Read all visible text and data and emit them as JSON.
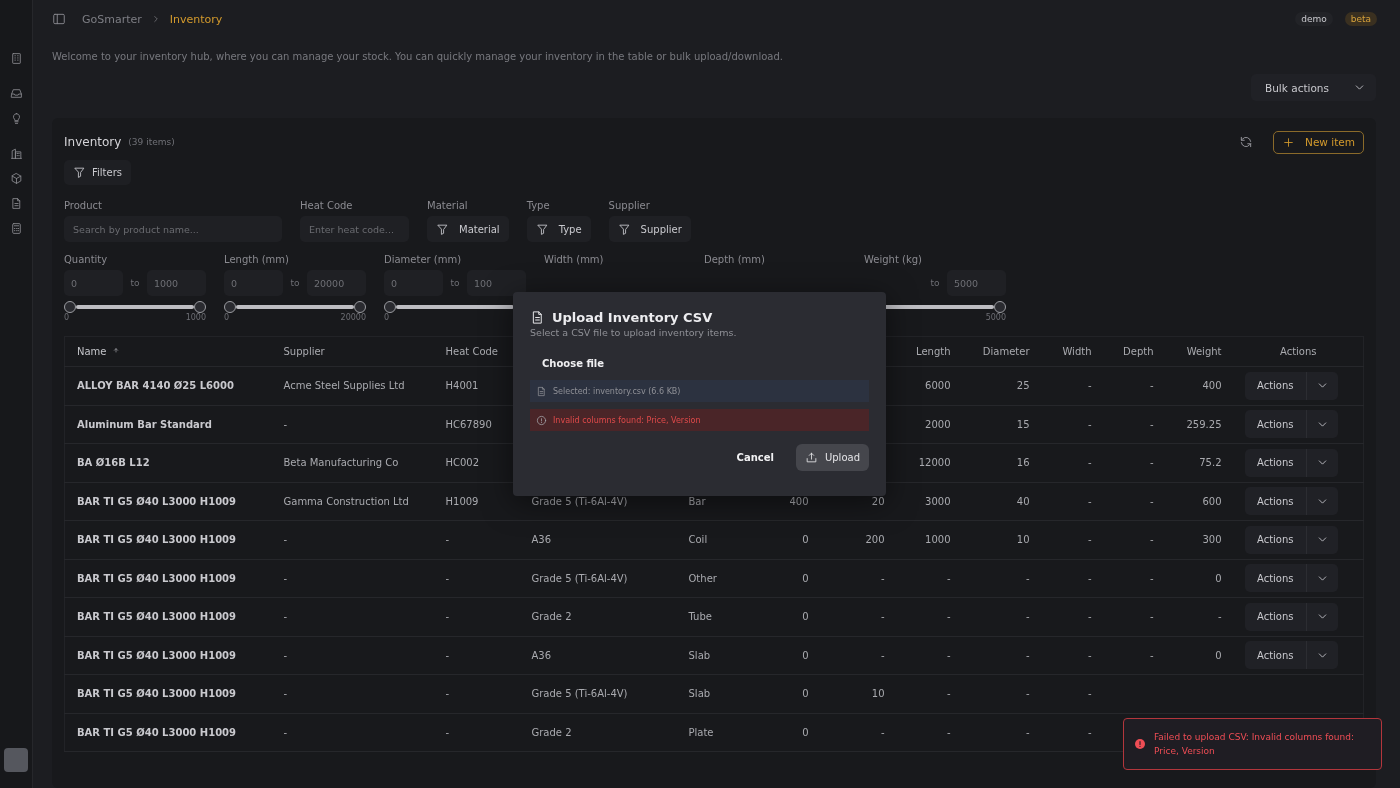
{
  "breadcrumb": {
    "items": [
      {
        "label": "GoSmarter",
        "selected": false
      },
      {
        "label": "Inventory",
        "selected": true
      }
    ]
  },
  "user_badges": [
    {
      "label": "demo",
      "kind": "plain"
    },
    {
      "label": "beta",
      "kind": "accent"
    }
  ],
  "description": "Welcome to your inventory hub, where you can manage your stock. You can quickly manage your inventory in the table or bulk upload/download.",
  "bulk_actions": {
    "label": "Bulk actions"
  },
  "card": {
    "title": "Inventory",
    "count": "(39 items)",
    "new_item": "New item",
    "filters_button": "Filters",
    "text_filters": [
      {
        "label": "Product",
        "kind": "input",
        "placeholder": "Search by product name..."
      },
      {
        "label": "Heat Code",
        "kind": "input",
        "placeholder": "Enter heat code..."
      },
      {
        "label": "Material",
        "kind": "select",
        "value": "Material"
      },
      {
        "label": "Type",
        "kind": "select",
        "value": "Type"
      },
      {
        "label": "Supplier",
        "kind": "select",
        "value": "Supplier"
      }
    ],
    "range_filters": [
      {
        "label": "Quantity",
        "min": "0",
        "to": "to",
        "max": "1000",
        "tick_min": "0",
        "tick_max": "1000",
        "thumbs": [
          {
            "level": 0
          },
          {
            "level": 1
          }
        ]
      },
      {
        "label": "Length (mm)",
        "min": "0",
        "to": "to",
        "max": "20000",
        "tick_min": "0",
        "tick_max": "20000",
        "thumbs": [
          {
            "level": 0
          },
          {
            "level": 1
          }
        ]
      },
      {
        "label": "Diameter (mm)",
        "min": "0",
        "to": "to",
        "max": "100",
        "tick_min": "0",
        "thumbs": [
          {
            "level": 0
          }
        ]
      },
      {
        "label": "Width (mm)"
      },
      {
        "label": "Depth (mm)"
      },
      {
        "label": "Weight (kg)",
        "to": "to",
        "max": "5000",
        "tick_max": "5000",
        "thumbs": [
          {
            "level": 1
          }
        ]
      }
    ]
  },
  "table": {
    "columns": [
      {
        "label": "Name",
        "sorted": true
      },
      {
        "label": "Supplier",
        "sorted": false
      },
      {
        "label": "Heat Code",
        "sorted": false
      },
      {},
      {},
      {},
      {},
      {
        "label": "Length",
        "sorted": false
      },
      {
        "label": "Diameter",
        "sorted": false
      },
      {
        "label": "Width",
        "sorted": false
      },
      {
        "label": "Depth",
        "sorted": false
      },
      {
        "label": "Weight",
        "sorted": false
      },
      {
        "label": "Actions",
        "sorted": false
      }
    ],
    "rows": [
      {
        "cells": [
          "ALLOY BAR 4140 Ø25 L6000",
          "Acme Steel Supplies Ltd",
          "H4001",
          null,
          null,
          null,
          null,
          "6000",
          "25",
          "-",
          "-",
          "400"
        ],
        "action": "Actions"
      },
      {
        "cells": [
          "Aluminum Bar Standard",
          "-",
          "HC67890",
          null,
          null,
          null,
          null,
          "2000",
          "15",
          "-",
          "-",
          "259.25"
        ],
        "action": "Actions"
      },
      {
        "cells": [
          "BA Ø16B L12",
          "Beta Manufacturing Co",
          "HC002",
          null,
          null,
          null,
          null,
          "12000",
          "16",
          "-",
          "-",
          "75.2"
        ],
        "action": "Actions"
      },
      {
        "cells": [
          "BAR TI G5 Ø40 L3000 H1009",
          "Gamma Construction Ltd",
          "H1009",
          "Grade 5 (Ti-6Al-4V)",
          "Bar",
          "400",
          "20",
          "3000",
          "40",
          "-",
          "-",
          "600"
        ],
        "action": "Actions"
      },
      {
        "cells": [
          "BAR TI G5 Ø40 L3000 H1009",
          "-",
          "-",
          "A36",
          "Coil",
          "0",
          "200",
          "1000",
          "10",
          "-",
          "-",
          "300"
        ],
        "action": "Actions"
      },
      {
        "cells": [
          "BAR TI G5 Ø40 L3000 H1009",
          "-",
          "-",
          "Grade 5 (Ti-6Al-4V)",
          "Other",
          "0",
          "-",
          "-",
          "-",
          "-",
          "-",
          "0"
        ],
        "action": "Actions"
      },
      {
        "cells": [
          "BAR TI G5 Ø40 L3000 H1009",
          "-",
          "-",
          "Grade 2",
          "Tube",
          "0",
          "-",
          "-",
          "-",
          "-",
          "-",
          "-"
        ],
        "action": "Actions"
      },
      {
        "cells": [
          "BAR TI G5 Ø40 L3000 H1009",
          "-",
          "-",
          "A36",
          "Slab",
          "0",
          "-",
          "-",
          "-",
          "-",
          "-",
          "0"
        ],
        "action": "Actions"
      },
      {
        "cells": [
          "BAR TI G5 Ø40 L3000 H1009",
          "-",
          "-",
          "Grade 5 (Ti-6Al-4V)",
          "Slab",
          "0",
          "10",
          "-",
          "-",
          "-",
          null,
          null
        ],
        "action": null
      },
      {
        "cells": [
          "BAR TI G5 Ø40 L3000 H1009",
          "-",
          "-",
          "Grade 2",
          "Plate",
          "0",
          "-",
          "-",
          "-",
          "-",
          null,
          null
        ],
        "action": null
      }
    ]
  },
  "dialog": {
    "title": "Upload Inventory CSV",
    "subtitle": "Select a CSV file to upload inventory items.",
    "choose_file": "Choose file",
    "selected_file": "Selected: inventory.csv (6.6 KB)",
    "error": "Invalid columns found: Price, Version",
    "cancel": "Cancel",
    "upload": "Upload"
  },
  "toast": {
    "kind": "error",
    "message": "Failed to upload CSV: Invalid columns found: Price, Version"
  }
}
